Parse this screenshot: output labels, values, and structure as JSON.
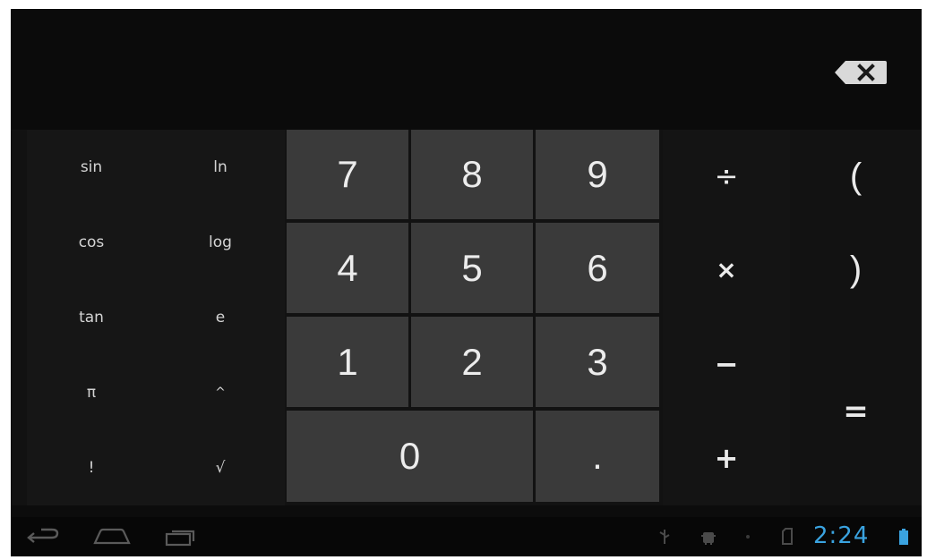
{
  "display": {
    "expression": ""
  },
  "advanced": {
    "keys": [
      {
        "name": "sin",
        "label": "sin"
      },
      {
        "name": "ln",
        "label": "ln"
      },
      {
        "name": "cos",
        "label": "cos"
      },
      {
        "name": "log",
        "label": "log"
      },
      {
        "name": "tan",
        "label": "tan"
      },
      {
        "name": "e",
        "label": "e"
      },
      {
        "name": "pi",
        "label": "π"
      },
      {
        "name": "power",
        "label": "^"
      },
      {
        "name": "factorial",
        "label": "!"
      },
      {
        "name": "sqrt",
        "label": "√"
      }
    ]
  },
  "digits": {
    "keys": [
      {
        "name": "7",
        "label": "7"
      },
      {
        "name": "8",
        "label": "8"
      },
      {
        "name": "9",
        "label": "9"
      },
      {
        "name": "4",
        "label": "4"
      },
      {
        "name": "5",
        "label": "5"
      },
      {
        "name": "6",
        "label": "6"
      },
      {
        "name": "1",
        "label": "1"
      },
      {
        "name": "2",
        "label": "2"
      },
      {
        "name": "3",
        "label": "3"
      },
      {
        "name": "0",
        "label": "0"
      },
      {
        "name": "decimal",
        "label": "."
      }
    ]
  },
  "operators": {
    "divide": "÷",
    "multiply": "×",
    "minus": "−",
    "plus": "+",
    "equals": "=",
    "open_paren": "(",
    "close_paren": ")"
  },
  "status_bar": {
    "time": "2:24"
  },
  "icons": {
    "delete": "backspace-icon",
    "back": "back-icon",
    "home": "home-icon",
    "recents": "recents-icon",
    "usb": "usb-icon",
    "android": "android-debug-icon",
    "sd": "sd-card-icon",
    "battery": "battery-icon"
  },
  "colors": {
    "background": "#0c0c0c",
    "digit_key": "#3a3a3a",
    "clock": "#3aa3e0"
  }
}
